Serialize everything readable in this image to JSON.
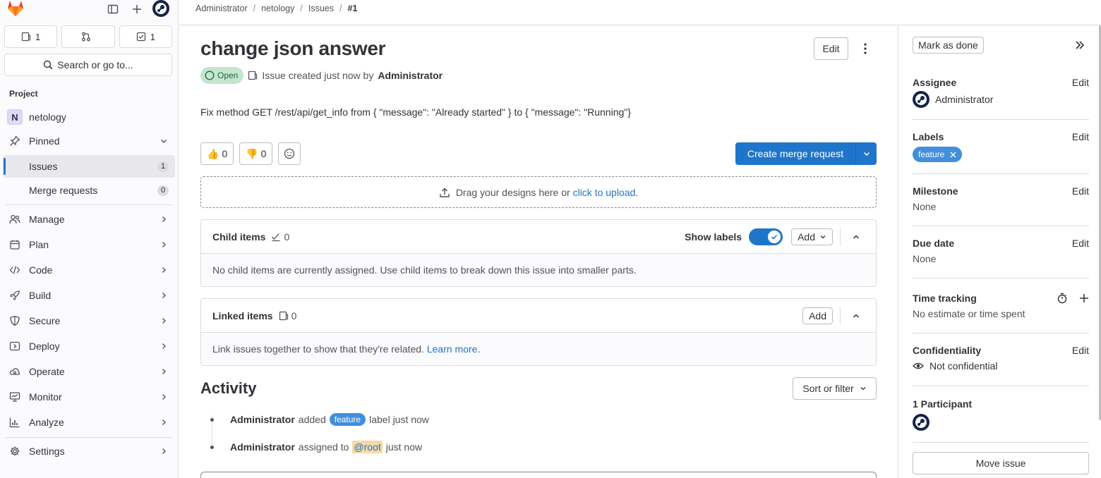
{
  "colors": {
    "brand": "#fc6d26",
    "primary": "#1f75cb",
    "label": "#428fdc",
    "open_badge_bg": "#c3e6cd",
    "sidebar_bg": "#fbfafd"
  },
  "sidebar": {
    "counters": [
      {
        "icon": "issues-icon",
        "count": "1"
      },
      {
        "icon": "merge-request-icon",
        "count": ""
      },
      {
        "icon": "todo-icon",
        "count": "1"
      }
    ],
    "search_label": "Search or go to...",
    "section_label": "Project",
    "project": {
      "initial": "N",
      "name": "netology"
    },
    "pinned_label": "Pinned",
    "pinned_items": [
      {
        "label": "Issues",
        "badge": "1"
      },
      {
        "label": "Merge requests",
        "badge": "0"
      }
    ],
    "menu": [
      {
        "label": "Manage",
        "icon": "users-icon"
      },
      {
        "label": "Plan",
        "icon": "calendar-icon"
      },
      {
        "label": "Code",
        "icon": "code-icon"
      },
      {
        "label": "Build",
        "icon": "rocket-icon"
      },
      {
        "label": "Secure",
        "icon": "shield-icon"
      },
      {
        "label": "Deploy",
        "icon": "deploy-icon"
      },
      {
        "label": "Operate",
        "icon": "cloud-gear-icon"
      },
      {
        "label": "Monitor",
        "icon": "monitor-icon"
      },
      {
        "label": "Analyze",
        "icon": "chart-icon"
      }
    ],
    "settings_label": "Settings"
  },
  "breadcrumb": [
    "Administrator",
    "netology",
    "Issues",
    "#1"
  ],
  "issue": {
    "title": "change json answer",
    "edit_label": "Edit",
    "status": "Open",
    "created_text": "Issue created just now by",
    "author": "Administrator",
    "description": "Fix method GET /rest/api/get_info from { \"message\": \"Already started\" } to { \"message\": \"Running\"}",
    "thumbs_up": "0",
    "thumbs_down": "0",
    "create_mr_label": "Create merge request",
    "dropzone_text": "Drag your designs here or",
    "dropzone_link": "click to upload",
    "dropzone_end": "."
  },
  "child_items": {
    "title": "Child items",
    "count": "0",
    "show_labels": "Show labels",
    "add_label": "Add",
    "empty_text": "No child items are currently assigned. Use child items to break down this issue into smaller parts."
  },
  "linked_items": {
    "title": "Linked items",
    "count": "0",
    "add_label": "Add",
    "empty_text": "Link issues together to show that they're related.",
    "learn_more": "Learn more."
  },
  "activity": {
    "title": "Activity",
    "sort_label": "Sort or filter",
    "events": [
      {
        "author": "Administrator",
        "pre": "added",
        "label": "feature",
        "post": "label just now"
      },
      {
        "author": "Administrator",
        "pre": "assigned to",
        "mention": "@root",
        "post": "just now"
      }
    ]
  },
  "right": {
    "mark_done": "Mark as done",
    "edit": "Edit",
    "assignee_title": "Assignee",
    "assignee_name": "Administrator",
    "labels_title": "Labels",
    "label_name": "feature",
    "milestone_title": "Milestone",
    "milestone_value": "None",
    "due_title": "Due date",
    "due_value": "None",
    "time_title": "Time tracking",
    "time_value": "No estimate or time spent",
    "conf_title": "Confidentiality",
    "conf_value": "Not confidential",
    "participants_title": "1 Participant",
    "move_label": "Move issue"
  }
}
